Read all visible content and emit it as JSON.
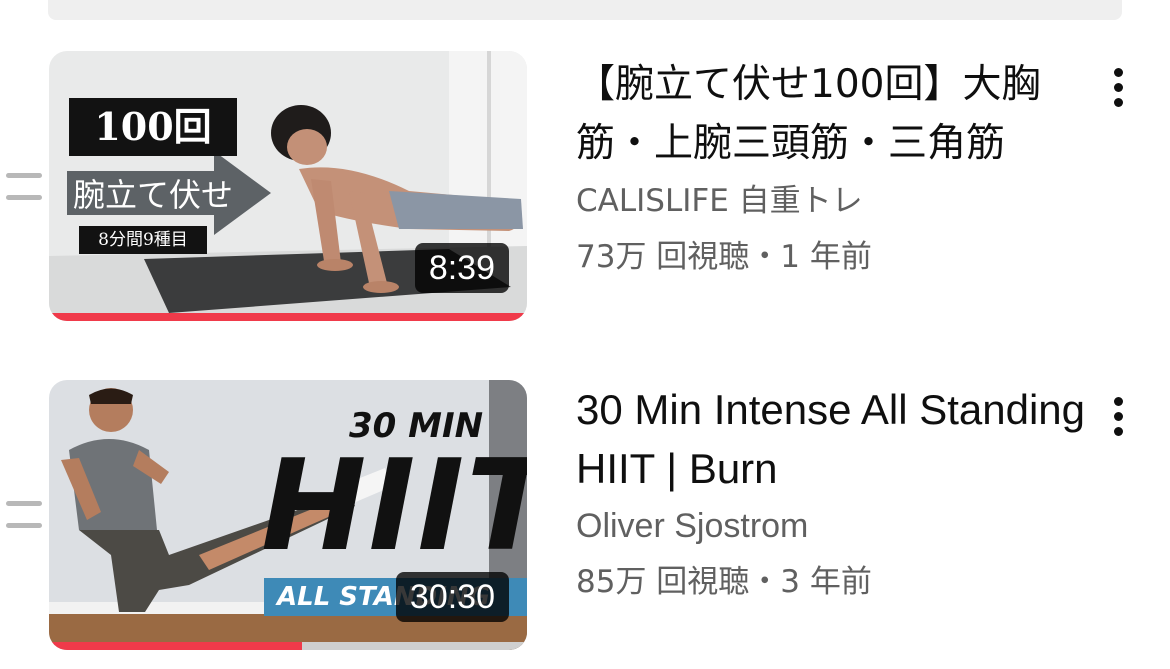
{
  "videos": [
    {
      "title": "【腕立て伏せ100回】大胸筋・上腕三頭筋・三角筋",
      "channel": "CALISLIFE 自重トレ",
      "meta": "73万 回視聴・1 年前",
      "duration": "8:39",
      "progress": 1.0,
      "thumbnail": {
        "badge": "100回",
        "banner": "腕立て伏せ",
        "caption": "8分間9種目"
      }
    },
    {
      "title": "30 Min Intense All Standing HIIT | Burn",
      "channel": "Oliver Sjostrom",
      "meta": "85万 回視聴・3 年前",
      "duration": "30:30",
      "progress": 0.53,
      "thumbnail": {
        "top_text": "30 MIN",
        "big_text": "HIIT",
        "banner": "ALL STANDING"
      }
    }
  ],
  "colors": {
    "progress": "#f03a4a",
    "title": "#0f0f0f",
    "secondary": "#606060"
  },
  "icons": [
    "drag-handle-icon",
    "more-vert-icon"
  ]
}
